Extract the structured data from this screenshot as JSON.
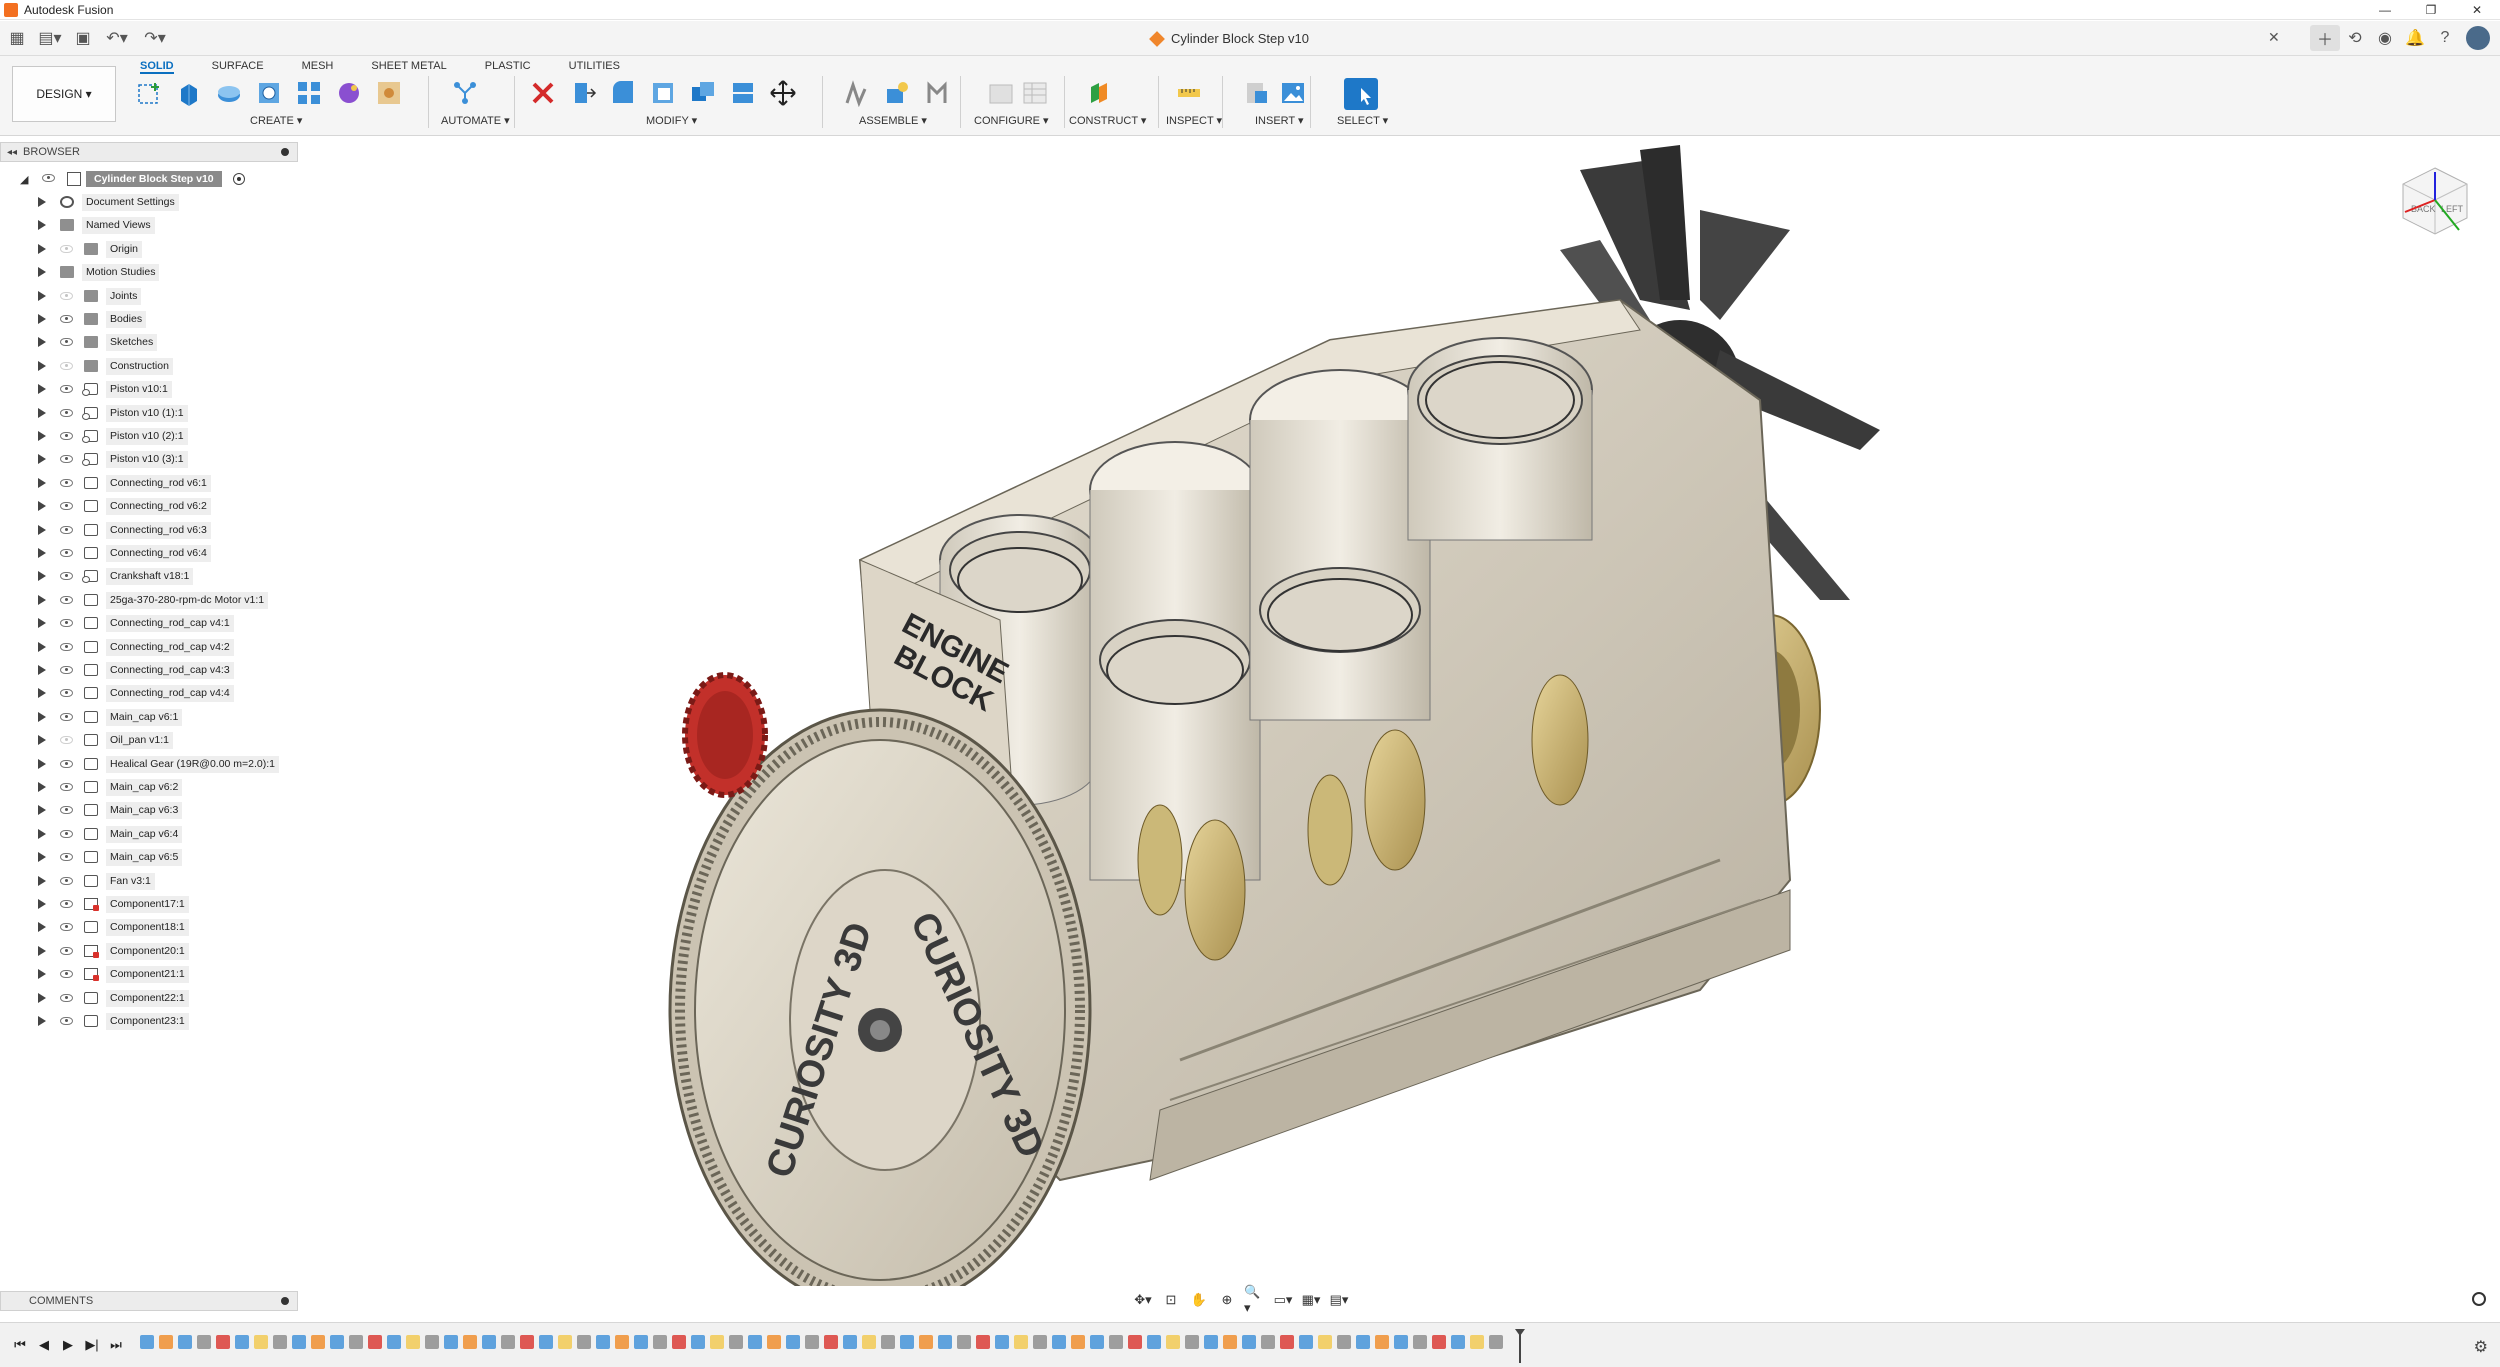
{
  "app": {
    "title": "Autodesk Fusion"
  },
  "document": {
    "tab_title": "Cylinder Block Step v10",
    "close_glyph": "✕"
  },
  "ribbon": {
    "workspace_label": "DESIGN ▾",
    "tabs": [
      "SOLID",
      "SURFACE",
      "MESH",
      "SHEET METAL",
      "PLASTIC",
      "UTILITIES"
    ],
    "groups": [
      "CREATE ▾",
      "AUTOMATE ▾",
      "MODIFY ▾",
      "ASSEMBLE ▾",
      "CONFIGURE ▾",
      "CONSTRUCT ▾",
      "INSPECT ▾",
      "INSERT ▾",
      "SELECT ▾"
    ]
  },
  "browser": {
    "header": "BROWSER",
    "root_label": "Cylinder Block Step v10",
    "items": [
      {
        "label": "Document Settings",
        "icon": "gear-icon",
        "eye": "none"
      },
      {
        "label": "Named Views",
        "icon": "folder-icon",
        "eye": "none"
      },
      {
        "label": "Origin",
        "icon": "folder-icon",
        "eye": "dim"
      },
      {
        "label": "Motion Studies",
        "icon": "folder-icon",
        "eye": "none"
      },
      {
        "label": "Joints",
        "icon": "folder-icon",
        "eye": "dim"
      },
      {
        "label": "Bodies",
        "icon": "folder-icon",
        "eye": "on"
      },
      {
        "label": "Sketches",
        "icon": "folder-icon",
        "eye": "on"
      },
      {
        "label": "Construction",
        "icon": "folder-icon",
        "eye": "dim"
      },
      {
        "label": "Piston v10:1",
        "icon": "linked-component-icon",
        "eye": "on"
      },
      {
        "label": "Piston v10 (1):1",
        "icon": "linked-component-icon",
        "eye": "on"
      },
      {
        "label": "Piston v10 (2):1",
        "icon": "linked-component-icon",
        "eye": "on"
      },
      {
        "label": "Piston v10 (3):1",
        "icon": "linked-component-icon",
        "eye": "on"
      },
      {
        "label": "Connecting_rod v6:1",
        "icon": "component-icon",
        "eye": "on"
      },
      {
        "label": "Connecting_rod v6:2",
        "icon": "component-icon",
        "eye": "on"
      },
      {
        "label": "Connecting_rod v6:3",
        "icon": "component-icon",
        "eye": "on"
      },
      {
        "label": "Connecting_rod v6:4",
        "icon": "component-icon",
        "eye": "on"
      },
      {
        "label": "Crankshaft v18:1",
        "icon": "linked-component-icon",
        "eye": "on"
      },
      {
        "label": "25ga-370-280-rpm-dc Motor v1:1",
        "icon": "component-icon",
        "eye": "on"
      },
      {
        "label": "Connecting_rod_cap v4:1",
        "icon": "component-icon",
        "eye": "on"
      },
      {
        "label": "Connecting_rod_cap v4:2",
        "icon": "component-icon",
        "eye": "on"
      },
      {
        "label": "Connecting_rod_cap v4:3",
        "icon": "component-icon",
        "eye": "on"
      },
      {
        "label": "Connecting_rod_cap v4:4",
        "icon": "component-icon",
        "eye": "on"
      },
      {
        "label": "Main_cap v6:1",
        "icon": "component-icon",
        "eye": "on"
      },
      {
        "label": "Oil_pan v1:1",
        "icon": "component-icon",
        "eye": "dim"
      },
      {
        "label": "Healical Gear (19R@0.00 m=2.0):1",
        "icon": "component-icon",
        "eye": "on"
      },
      {
        "label": "Main_cap v6:2",
        "icon": "component-icon",
        "eye": "on"
      },
      {
        "label": "Main_cap v6:3",
        "icon": "component-icon",
        "eye": "on"
      },
      {
        "label": "Main_cap v6:4",
        "icon": "component-icon",
        "eye": "on"
      },
      {
        "label": "Main_cap v6:5",
        "icon": "component-icon",
        "eye": "on"
      },
      {
        "label": "Fan v3:1",
        "icon": "component-icon",
        "eye": "on"
      },
      {
        "label": "Component17:1",
        "icon": "component-error-icon",
        "eye": "on"
      },
      {
        "label": "Component18:1",
        "icon": "component-icon",
        "eye": "on"
      },
      {
        "label": "Component20:1",
        "icon": "component-error-icon",
        "eye": "on"
      },
      {
        "label": "Component21:1",
        "icon": "component-error-icon",
        "eye": "on"
      },
      {
        "label": "Component22:1",
        "icon": "component-icon",
        "eye": "on"
      },
      {
        "label": "Component23:1",
        "icon": "component-icon",
        "eye": "on"
      }
    ]
  },
  "model": {
    "block_label_1": "ENGINE",
    "block_label_2": "BLOCK",
    "brand": "CURIOSITY 3D"
  },
  "viewcube": {
    "face_left": "LEFT",
    "face_back": "BACK"
  },
  "comments": {
    "header": "COMMENTS"
  },
  "colors": {
    "accent": "#0a6fc0",
    "body": "#d9d2c3",
    "body_shade": "#b9b1a1",
    "brass": "#c9b26e",
    "gear_red": "#c2302a",
    "fan": "#3c3c3c"
  }
}
